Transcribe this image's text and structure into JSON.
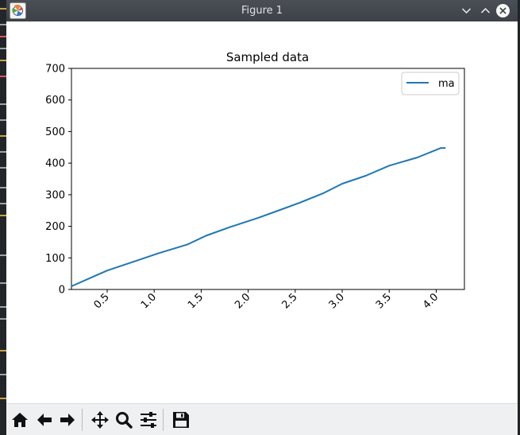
{
  "window": {
    "title": "Figure 1"
  },
  "chart_data": {
    "type": "line",
    "title": "Sampled data",
    "xlabel": "",
    "ylabel": "",
    "xlim": [
      0.12,
      4.3
    ],
    "ylim": [
      0,
      700
    ],
    "x_ticks": [
      "0.5",
      "1.0",
      "1.5",
      "2.0",
      "2.5",
      "3.0",
      "3.5",
      "4.0"
    ],
    "x_tick_values": [
      0.5,
      1.0,
      1.5,
      2.0,
      2.5,
      3.0,
      3.5,
      4.0
    ],
    "y_ticks": [
      "0",
      "100",
      "200",
      "300",
      "400",
      "500",
      "600",
      "700"
    ],
    "y_tick_values": [
      0,
      100,
      200,
      300,
      400,
      500,
      600,
      700
    ],
    "grid": false,
    "legend_position": "top-right",
    "series": [
      {
        "name": "ma",
        "color": "#1f77b4",
        "x": [
          0.12,
          0.5,
          0.8,
          1.05,
          1.35,
          1.55,
          1.8,
          2.1,
          2.35,
          2.55,
          2.8,
          3.0,
          3.25,
          3.5,
          3.8,
          4.05,
          4.1
        ],
        "y": [
          10,
          60,
          90,
          115,
          142,
          170,
          197,
          226,
          253,
          275,
          305,
          335,
          360,
          392,
          418,
          448,
          448
        ]
      }
    ]
  },
  "toolbar": {
    "tools": [
      {
        "name": "home-button",
        "icon": "home-icon"
      },
      {
        "name": "back-button",
        "icon": "arrow-left-icon"
      },
      {
        "name": "forward-button",
        "icon": "arrow-right-icon"
      },
      {
        "name": "pan-button",
        "icon": "move-icon"
      },
      {
        "name": "zoom-button",
        "icon": "magnifier-icon"
      },
      {
        "name": "configure-subplots-button",
        "icon": "sliders-icon"
      },
      {
        "name": "save-button",
        "icon": "floppy-disk-icon"
      }
    ]
  }
}
